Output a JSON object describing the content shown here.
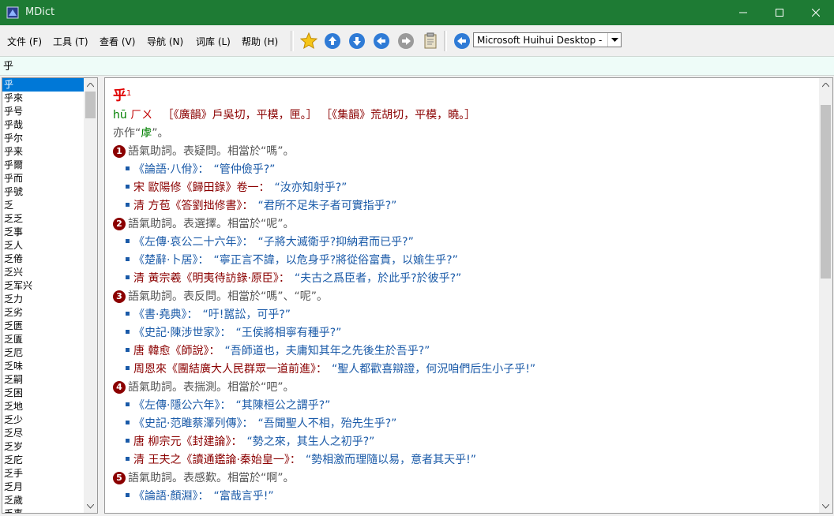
{
  "window": {
    "title": "MDict"
  },
  "menu": [
    "文件 (F)",
    "工具 (T)",
    "查看 (V)",
    "导航 (N)",
    "词库 (L)",
    "帮助 (H)"
  ],
  "toolbar": {
    "dictionary": "Microsoft Huihui Desktop - C"
  },
  "search": {
    "value": "乎"
  },
  "wordlist": [
    "乎",
    "乎來",
    "乎号",
    "乎哉",
    "乎尔",
    "乎来",
    "乎爾",
    "乎而",
    "乎號",
    "乏",
    "乏乏",
    "乏事",
    "乏人",
    "乏倦",
    "乏兴",
    "乏军兴",
    "乏力",
    "乏劣",
    "乏匮",
    "乏匱",
    "乏厄",
    "乏味",
    "乏嗣",
    "乏困",
    "乏地",
    "乏少",
    "乏尽",
    "乏岁",
    "乏庀",
    "乏手",
    "乏月",
    "乏歲",
    "乏事"
  ],
  "entry": {
    "headword": "乎",
    "superscript": "1",
    "pinyin": "hū",
    "zhuyin": "ㄏㄨ",
    "rhymes": "［《廣韻》戶吳切，平模，匣。］ ［《集韻》荒胡切，平模，曉。］",
    "alt_prefix": "亦作“",
    "alt_char": "虖",
    "alt_suffix": "”。",
    "senses": [
      {
        "num": "1",
        "def": "語氣助詞。表疑問。相當於“嗎”。",
        "examples": [
          {
            "src": "《論語·八佾》：",
            "src_style": "blue",
            "quote": "“管仲儉乎?”"
          },
          {
            "src": "宋 歐陽修《歸田錄》卷一：",
            "src_style": "red",
            "quote": "“汝亦知射乎?”"
          },
          {
            "src": "清 方苞《答劉拙修書》：",
            "src_style": "red",
            "quote": "“君所不足朱子者可實指乎?”"
          }
        ]
      },
      {
        "num": "2",
        "def": "語氣助詞。表選擇。相當於“呢”。",
        "examples": [
          {
            "src": "《左傳·哀公二十六年》：",
            "src_style": "blue",
            "quote": "“子將大滅衛乎?抑納君而已乎?”"
          },
          {
            "src": "《楚辭·卜居》：",
            "src_style": "blue",
            "quote": "“寧正言不諱，以危身乎?將從俗富貴，以媮生乎?”"
          },
          {
            "src": "清 黃宗羲《明夷待訪錄·原臣》：",
            "src_style": "red",
            "quote": "“夫古之爲臣者，於此乎?於彼乎?”"
          }
        ]
      },
      {
        "num": "3",
        "def": "語氣助詞。表反問。相當於“嗎”、“呢”。",
        "examples": [
          {
            "src": "《書·堯典》：",
            "src_style": "blue",
            "quote": "“吁!嚚訟，可乎?”"
          },
          {
            "src": "《史記·陳涉世家》：",
            "src_style": "blue",
            "quote": "“王侯將相寧有種乎?”"
          },
          {
            "src": "唐 韓愈《師說》：",
            "src_style": "red",
            "quote": "“吾師道也，夫庸知其年之先後生於吾乎?”"
          },
          {
            "src": "周恩來《團結廣大人民群眾一道前進》：",
            "src_style": "red",
            "quote": "“聖人都歡喜辯證，何況咱們后生小子乎!”"
          }
        ]
      },
      {
        "num": "4",
        "def": "語氣助詞。表揣測。相當於“吧”。",
        "examples": [
          {
            "src": "《左傳·隱公六年》：",
            "src_style": "blue",
            "quote": "“其陳桓公之謂乎?”"
          },
          {
            "src": "《史記·范雎蔡澤列傳》：",
            "src_style": "blue",
            "quote": "“吾聞聖人不相，殆先生乎?”"
          },
          {
            "src": "唐 柳宗元《封建論》：",
            "src_style": "red",
            "quote": "“勢之來，其生人之初乎?”"
          },
          {
            "src": "清 王夫之《讀通鑑論·秦始皇一》：",
            "src_style": "red",
            "quote": "“勢相激而理隨以易，意者其天乎!”"
          }
        ]
      },
      {
        "num": "5",
        "def": "語氣助詞。表感歎。相當於“啊”。",
        "examples": [
          {
            "src": "《論語·顏淵》：",
            "src_style": "blue",
            "quote": "“富哉言乎!”"
          }
        ]
      }
    ]
  }
}
